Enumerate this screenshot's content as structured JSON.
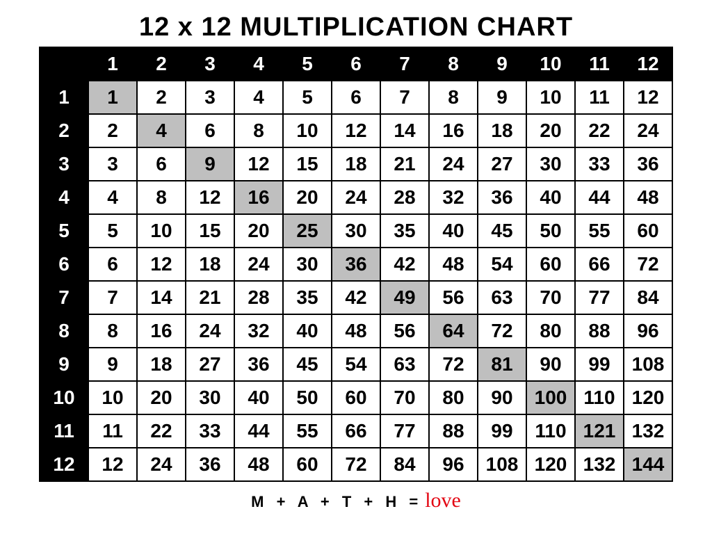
{
  "title": "12 x 12 MULTIPLICATION CHART",
  "size": 12,
  "col_headers": [
    1,
    2,
    3,
    4,
    5,
    6,
    7,
    8,
    9,
    10,
    11,
    12
  ],
  "row_headers": [
    1,
    2,
    3,
    4,
    5,
    6,
    7,
    8,
    9,
    10,
    11,
    12
  ],
  "footer": {
    "math": "M + A + T + H =",
    "love": "love"
  },
  "chart_data": {
    "type": "table",
    "title": "12 x 12 MULTIPLICATION CHART",
    "columns": [
      1,
      2,
      3,
      4,
      5,
      6,
      7,
      8,
      9,
      10,
      11,
      12
    ],
    "rows": [
      1,
      2,
      3,
      4,
      5,
      6,
      7,
      8,
      9,
      10,
      11,
      12
    ],
    "values": [
      [
        1,
        2,
        3,
        4,
        5,
        6,
        7,
        8,
        9,
        10,
        11,
        12
      ],
      [
        2,
        4,
        6,
        8,
        10,
        12,
        14,
        16,
        18,
        20,
        22,
        24
      ],
      [
        3,
        6,
        9,
        12,
        15,
        18,
        21,
        24,
        27,
        30,
        33,
        36
      ],
      [
        4,
        8,
        12,
        16,
        20,
        24,
        28,
        32,
        36,
        40,
        44,
        48
      ],
      [
        5,
        10,
        15,
        20,
        25,
        30,
        35,
        40,
        45,
        50,
        55,
        60
      ],
      [
        6,
        12,
        18,
        24,
        30,
        36,
        42,
        48,
        54,
        60,
        66,
        72
      ],
      [
        7,
        14,
        21,
        28,
        35,
        42,
        49,
        56,
        63,
        70,
        77,
        84
      ],
      [
        8,
        16,
        24,
        32,
        40,
        48,
        56,
        64,
        72,
        80,
        88,
        96
      ],
      [
        9,
        18,
        27,
        36,
        45,
        54,
        63,
        72,
        81,
        90,
        99,
        108
      ],
      [
        10,
        20,
        30,
        40,
        50,
        60,
        70,
        80,
        90,
        100,
        110,
        120
      ],
      [
        11,
        22,
        33,
        44,
        55,
        66,
        77,
        88,
        99,
        110,
        121,
        132
      ],
      [
        12,
        24,
        36,
        48,
        60,
        72,
        84,
        96,
        108,
        120,
        132,
        144
      ]
    ],
    "diagonal_highlight": true
  }
}
